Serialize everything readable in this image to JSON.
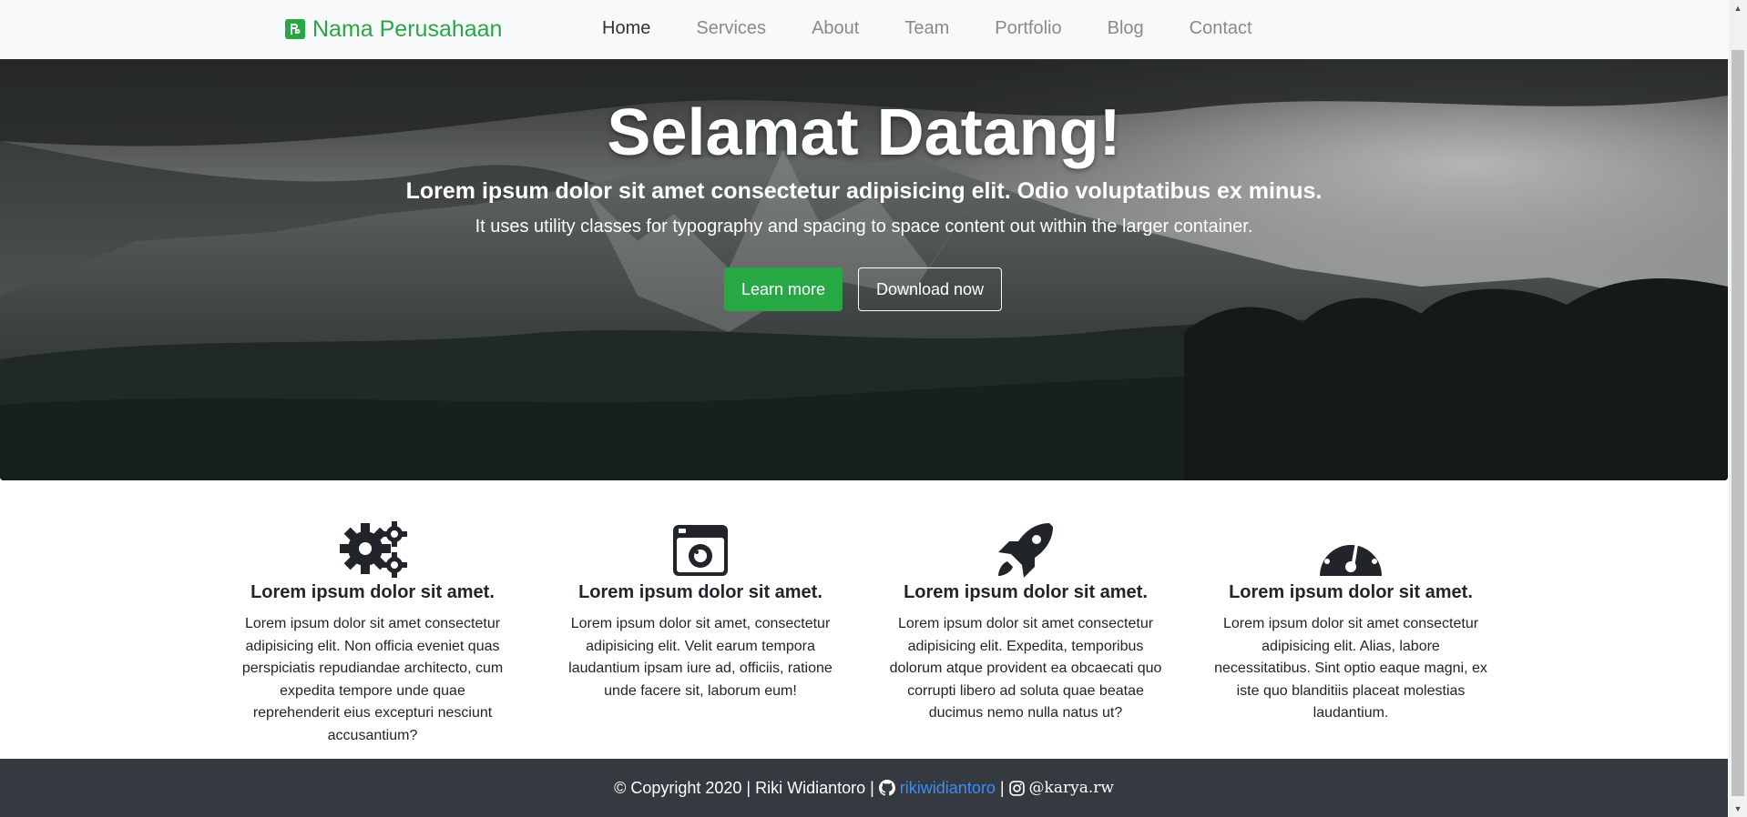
{
  "navbar": {
    "brand": "Nama Perusahaan",
    "links": [
      "Home",
      "Services",
      "About",
      "Team",
      "Portfolio",
      "Blog",
      "Contact"
    ],
    "active": "Home"
  },
  "hero": {
    "title": "Selamat Datang!",
    "lead": "Lorem ipsum dolor sit amet consectetur adipisicing elit. Odio voluptatibus ex minus.",
    "sub": "It uses utility classes for typography and spacing to space content out within the larger container.",
    "btn_primary": "Learn more",
    "btn_secondary": "Download now"
  },
  "features": [
    {
      "icon": "gears-icon",
      "title": "Lorem ipsum dolor sit amet.",
      "text": "Lorem ipsum dolor sit amet consectetur adipisicing elit. Non officia eveniet quas perspiciatis repudiandae architecto, cum expedita tempore unde quae reprehenderit eius excepturi nesciunt accusantium?"
    },
    {
      "icon": "camera-icon",
      "title": "Lorem ipsum dolor sit amet.",
      "text": "Lorem ipsum dolor sit amet, consectetur adipisicing elit. Velit earum tempora laudantium ipsam iure ad, officiis, ratione unde facere sit, laborum eum!"
    },
    {
      "icon": "rocket-icon",
      "title": "Lorem ipsum dolor sit amet.",
      "text": "Lorem ipsum dolor sit amet consectetur adipisicing elit. Expedita, temporibus dolorum atque provident ea obcaecati quo corrupti libero ad soluta quae beatae ducimus nemo nulla natus ut?"
    },
    {
      "icon": "speedometer-icon",
      "title": "Lorem ipsum dolor sit amet.",
      "text": "Lorem ipsum dolor sit amet consectetur adipisicing elit. Alias, labore necessitatibus. Sint optio eaque magni, ex iste quo blanditiis placeat molestias laudantium."
    }
  ],
  "footer": {
    "copyright": "© Copyright 2020 | Riki Widiantoro |",
    "github": "rikiwidiantoro",
    "separator": "|",
    "instagram": "@karya.rw"
  },
  "colors": {
    "accent": "#28a745",
    "footer_bg": "#343a40",
    "link": "#3b8cff"
  }
}
